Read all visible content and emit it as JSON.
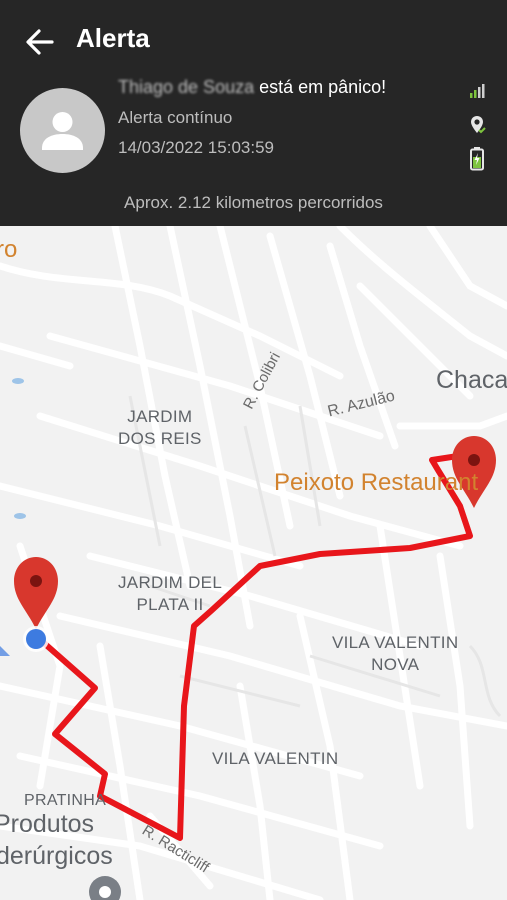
{
  "header": {
    "title": "Alerta",
    "person_name": "Thiago de Souza",
    "panic_text": " está em pânico!",
    "alert_type": "Alerta contínuo",
    "timestamp": "14/03/2022 15:03:59",
    "distance_text": "Aprox. 2.12 kilometros percorridos"
  },
  "icons": {
    "back": "arrow-left-icon",
    "avatar": "person-avatar-icon",
    "signal": "signal-icon",
    "gps": "gps-pin-icon",
    "battery": "battery-icon"
  },
  "colors": {
    "header_bg": "#262626",
    "route": "#e8161b",
    "marker": "#d8372d",
    "current_location": "#3d7be0",
    "map_bg": "#f2f2f2",
    "status_green": "#7ec43e"
  },
  "map": {
    "labels": {
      "edge_left": "ro",
      "jardim_dos_reis": "JARDIM\nDOS REIS",
      "colibri": "R. Colibri",
      "azulao": "R. Azulão",
      "chaca": "Chaca",
      "peixoto": "Peixoto Restaurant",
      "jardim_del_plata": "JARDIM DEL\nPLATA II",
      "vila_valentin_nova": "VILA VALENTIN\nNOVA",
      "vila_valentin": "VILA VALENTIN",
      "pratinha": "PRATINHA",
      "racticliff": "R. Racticliff",
      "produtos": "Produtos",
      "siderurgicos": "derúrgicos"
    }
  }
}
